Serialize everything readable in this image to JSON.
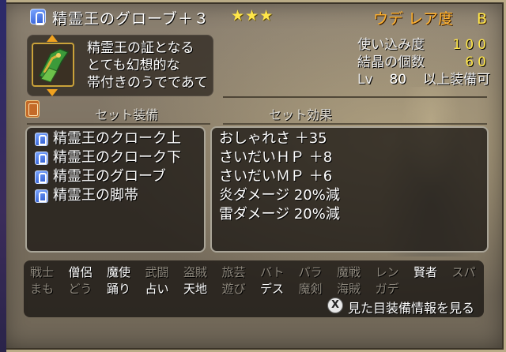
{
  "item": {
    "icon": "glove-icon",
    "name": "精霊王のグローブ＋３",
    "stars": "★★★",
    "rarity_label": "ウデ レア度",
    "rarity_grade": "B"
  },
  "description": {
    "lines": [
      "精霊王の証となる",
      "とても幻想的な",
      "帯付きのうでであて"
    ]
  },
  "stats": {
    "durability_label": "使い込み度",
    "durability_value": "100",
    "crystal_label": "結晶の個数",
    "crystal_value": "60",
    "level_prefix": "Lv",
    "level_value": "80",
    "level_suffix": "以上装備可"
  },
  "sections": {
    "set_equipment": "セット装備",
    "set_effects": "セット効果"
  },
  "set_items": [
    {
      "label": "精霊王のクローク上",
      "icon": "armor-top-icon"
    },
    {
      "label": "精霊王のクローク下",
      "icon": "armor-bottom-icon"
    },
    {
      "label": "精霊王のグローブ",
      "icon": "glove-icon"
    },
    {
      "label": "精霊王の脚帯",
      "icon": "boots-icon"
    }
  ],
  "set_effects": [
    "おしゃれさ ＋35",
    "さいだいＨＰ ＋8",
    "さいだいＭＰ ＋6",
    "炎ダメージ 20%減",
    "雷ダメージ 20%減"
  ],
  "jobs": [
    {
      "label": "戦士",
      "enabled": false
    },
    {
      "label": "僧侶",
      "enabled": true
    },
    {
      "label": "魔使",
      "enabled": true
    },
    {
      "label": "武闘",
      "enabled": false
    },
    {
      "label": "盗賊",
      "enabled": false
    },
    {
      "label": "旅芸",
      "enabled": false
    },
    {
      "label": "バト",
      "enabled": false
    },
    {
      "label": "パラ",
      "enabled": false
    },
    {
      "label": "魔戦",
      "enabled": false
    },
    {
      "label": "レン",
      "enabled": false
    },
    {
      "label": "賢者",
      "enabled": true
    },
    {
      "label": "スパ",
      "enabled": false
    },
    {
      "label": "まも",
      "enabled": false
    },
    {
      "label": "どう",
      "enabled": false
    },
    {
      "label": "踊り",
      "enabled": true
    },
    {
      "label": "占い",
      "enabled": true
    },
    {
      "label": "天地",
      "enabled": true
    },
    {
      "label": "遊び",
      "enabled": false
    },
    {
      "label": "デス",
      "enabled": true
    },
    {
      "label": "魔剣",
      "enabled": false
    },
    {
      "label": "海賊",
      "enabled": false
    },
    {
      "label": "ガデ",
      "enabled": false
    }
  ],
  "footer": {
    "button": "X",
    "hint": "見た目装備情報を見る"
  },
  "colors": {
    "accent_gold": "#ffe64a",
    "rarity_orange": "#ffb12e",
    "disabled_gray": "#8e887d"
  }
}
